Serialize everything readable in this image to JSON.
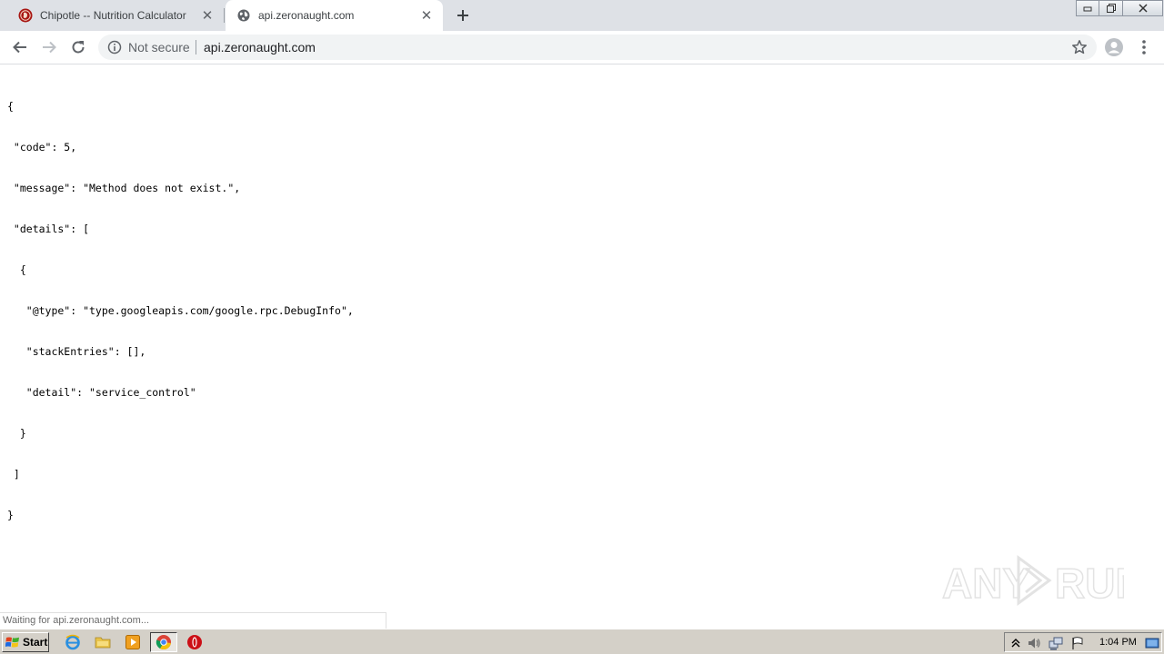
{
  "browser": {
    "tabs": [
      {
        "title": "Chipotle -- Nutrition Calculator",
        "favicon": "chipotle-logo-icon",
        "active": false
      },
      {
        "title": "api.zeronaught.com",
        "favicon": "globe-icon",
        "active": true
      }
    ],
    "omnibox": {
      "security_label": "Not secure",
      "url": "api.zeronaught.com"
    }
  },
  "page": {
    "json_lines": [
      "{",
      " \"code\": 5,",
      " \"message\": \"Method does not exist.\",",
      " \"details\": [",
      "  {",
      "   \"@type\": \"type.googleapis.com/google.rpc.DebugInfo\",",
      "   \"stackEntries\": [],",
      "   \"detail\": \"service_control\"",
      "  }",
      " ]",
      "}"
    ]
  },
  "status_bar": {
    "text": "Waiting for api.zeronaught.com..."
  },
  "watermark": {
    "text": "ANY RUN"
  },
  "taskbar": {
    "start_label": "Start",
    "clock": "1:04 PM"
  },
  "colors": {
    "tabstrip": "#dee1e6",
    "omnibox": "#f1f3f4",
    "taskbar": "#d4d0c8",
    "chipotle_red": "#a81612"
  }
}
